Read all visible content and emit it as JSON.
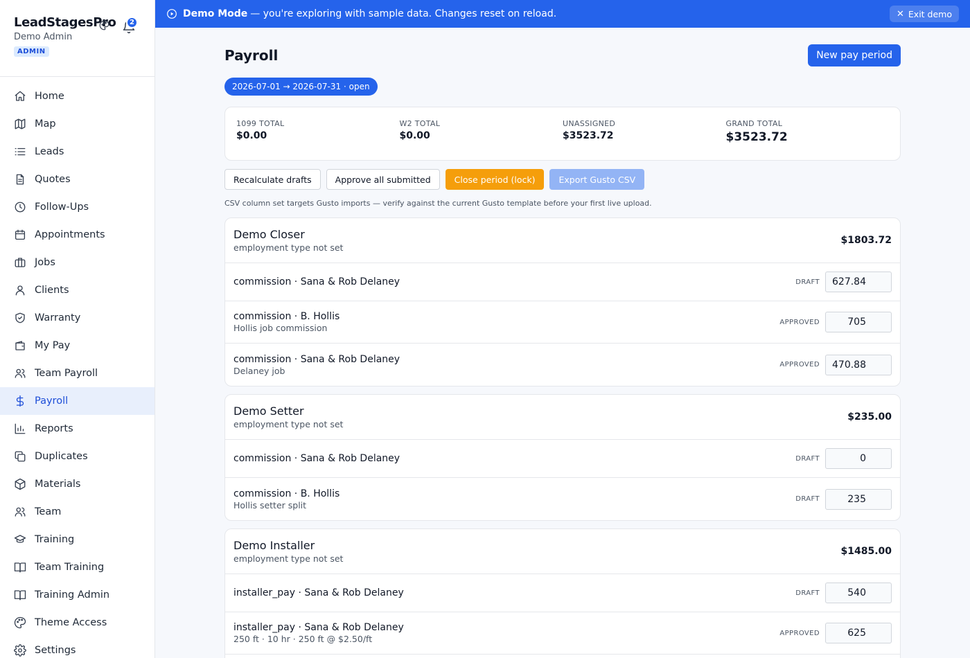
{
  "app": {
    "name": "LeadStagesPro",
    "user": "Demo Admin",
    "role": "ADMIN",
    "notification_count": "2"
  },
  "nav": [
    {
      "label": "Home",
      "icon": "home-icon"
    },
    {
      "label": "Map",
      "icon": "map-icon"
    },
    {
      "label": "Leads",
      "icon": "list-icon"
    },
    {
      "label": "Quotes",
      "icon": "document-icon"
    },
    {
      "label": "Follow-Ups",
      "icon": "clock-icon"
    },
    {
      "label": "Appointments",
      "icon": "calendar-icon"
    },
    {
      "label": "Jobs",
      "icon": "briefcase-icon"
    },
    {
      "label": "Clients",
      "icon": "user-icon"
    },
    {
      "label": "Warranty",
      "icon": "shield-icon"
    },
    {
      "label": "My Pay",
      "icon": "wallet-icon"
    },
    {
      "label": "Team Payroll",
      "icon": "users-icon"
    },
    {
      "label": "Payroll",
      "icon": "dollar-icon",
      "active": true
    },
    {
      "label": "Reports",
      "icon": "bar-chart-icon"
    },
    {
      "label": "Duplicates",
      "icon": "copy-icon"
    },
    {
      "label": "Materials",
      "icon": "box-icon"
    },
    {
      "label": "Team",
      "icon": "users-icon"
    },
    {
      "label": "Training",
      "icon": "graduation-cap-icon"
    },
    {
      "label": "Team Training",
      "icon": "book-icon"
    },
    {
      "label": "Training Admin",
      "icon": "book-icon"
    },
    {
      "label": "Theme Access",
      "icon": "palette-icon"
    },
    {
      "label": "Settings",
      "icon": "gear-icon"
    }
  ],
  "banner": {
    "title": "Demo Mode",
    "message": "— you're exploring with sample data. Changes reset on reload.",
    "exit_label": "Exit demo"
  },
  "page": {
    "title": "Payroll",
    "new_period_label": "New pay period",
    "period_pill": "2026-07-01 → 2026-07-31 · open"
  },
  "totals": [
    {
      "label": "1099 TOTAL",
      "value": "$0.00"
    },
    {
      "label": "W2 TOTAL",
      "value": "$0.00"
    },
    {
      "label": "UNASSIGNED",
      "value": "$3523.72"
    },
    {
      "label": "GRAND TOTAL",
      "value": "$3523.72"
    }
  ],
  "actions": {
    "recalculate": "Recalculate drafts",
    "approve_all": "Approve all submitted",
    "close_period": "Close period (lock)",
    "export_csv": "Export Gusto CSV"
  },
  "csv_note": "CSV column set targets Gusto imports — verify against the current Gusto template before your first live upload.",
  "people": [
    {
      "name": "Demo Closer",
      "type": "employment type not set",
      "total": "$1803.72",
      "lines": [
        {
          "title": "commission · Sana & Rob Delaney",
          "sub": "",
          "status": "DRAFT",
          "amount": "627.84"
        },
        {
          "title": "commission · B. Hollis",
          "sub": "Hollis job commission",
          "status": "APPROVED",
          "amount": "705"
        },
        {
          "title": "commission · Sana & Rob Delaney",
          "sub": "Delaney job",
          "status": "APPROVED",
          "amount": "470.88"
        }
      ]
    },
    {
      "name": "Demo Setter",
      "type": "employment type not set",
      "total": "$235.00",
      "lines": [
        {
          "title": "commission · Sana & Rob Delaney",
          "sub": "",
          "status": "DRAFT",
          "amount": "0"
        },
        {
          "title": "commission · B. Hollis",
          "sub": "Hollis setter split",
          "status": "DRAFT",
          "amount": "235"
        }
      ]
    },
    {
      "name": "Demo Installer",
      "type": "employment type not set",
      "total": "$1485.00",
      "lines": [
        {
          "title": "installer_pay · Sana & Rob Delaney",
          "sub": "",
          "status": "DRAFT",
          "amount": "540"
        },
        {
          "title": "installer_pay · Sana & Rob Delaney",
          "sub": "250 ft · 10 hr · 250 ft @ $2.50/ft",
          "status": "APPROVED",
          "amount": "625"
        }
      ]
    }
  ]
}
